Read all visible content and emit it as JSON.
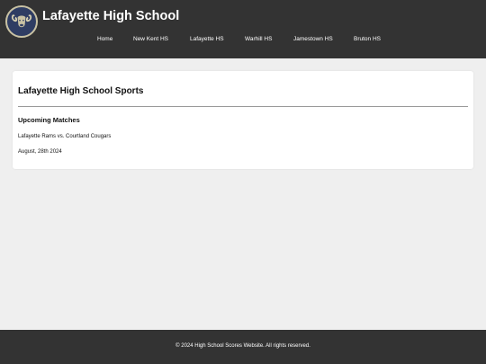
{
  "header": {
    "site_title": "Lafayette High School",
    "logo_icon": "ram-logo-icon",
    "logo_colors": {
      "background": "#2f3d63",
      "ring": "#c9c2a4"
    },
    "background_color": "#333333"
  },
  "nav": {
    "items": [
      {
        "label": "Home"
      },
      {
        "label": "New Kent HS"
      },
      {
        "label": "Lafayette HS"
      },
      {
        "label": "Warhill HS"
      },
      {
        "label": "Jamestown HS"
      },
      {
        "label": "Bruton HS"
      }
    ]
  },
  "main": {
    "page_title": "Lafayette High School Sports",
    "section_heading": "Upcoming Matches",
    "matches": [
      {
        "teams": "Lafayette Rams vs. Courtland Cougars",
        "date": "August, 28th 2024"
      }
    ]
  },
  "footer": {
    "text": "© 2024 High School Scores Website. All rights reserved."
  },
  "colors": {
    "page_background": "#efefef",
    "card_background": "#ffffff",
    "bar_background": "#333333",
    "bar_text": "#ffffff"
  }
}
